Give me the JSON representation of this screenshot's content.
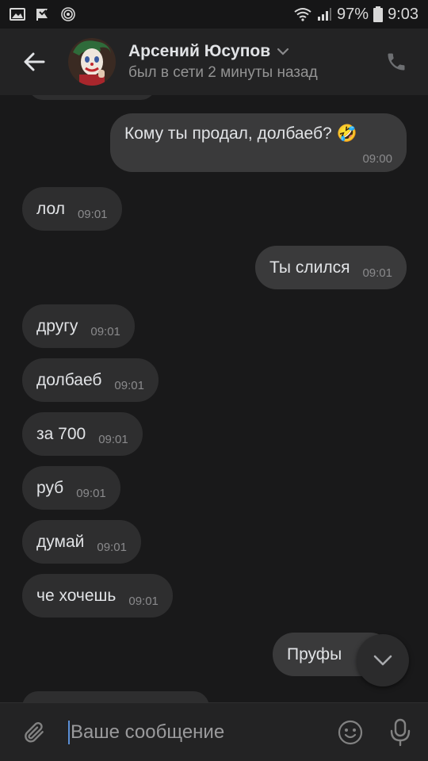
{
  "status_bar": {
    "battery": "97%",
    "time": "9:03"
  },
  "header": {
    "name": "Арсений Юсупов",
    "status": "был в сети 2 минуты назад"
  },
  "messages": [
    {
      "dir": "out",
      "text": "Кому ты продал, долбаеб? 🤣",
      "time": "09:00"
    },
    {
      "dir": "in",
      "text": "лол",
      "time": "09:01"
    },
    {
      "dir": "out",
      "text": "Ты слился",
      "time": "09:01"
    },
    {
      "dir": "in",
      "text": "другу",
      "time": "09:01"
    },
    {
      "dir": "in",
      "text": "долбаеб",
      "time": "09:01"
    },
    {
      "dir": "in",
      "text": "за 700",
      "time": "09:01"
    },
    {
      "dir": "in",
      "text": "руб",
      "time": "09:01"
    },
    {
      "dir": "in",
      "text": "думай",
      "time": "09:01"
    },
    {
      "dir": "in",
      "text": "че хочешь",
      "time": "09:01"
    },
    {
      "dir": "out",
      "text": "Пруфы",
      "time": ""
    }
  ],
  "composer": {
    "placeholder": "Ваше сообщение"
  },
  "colors": {
    "background": "#19191a",
    "bar": "#232324",
    "bubble_in": "#2e2e2f",
    "bubble_out": "#3a3a3b",
    "accent": "#5b8fd6"
  },
  "icons": [
    "gallery-icon",
    "flag-icon",
    "hotspot-icon",
    "wifi-icon",
    "signal-icon",
    "battery-icon",
    "back-arrow-icon",
    "chevron-down-icon",
    "phone-icon",
    "attach-icon",
    "emoji-icon",
    "mic-icon"
  ]
}
